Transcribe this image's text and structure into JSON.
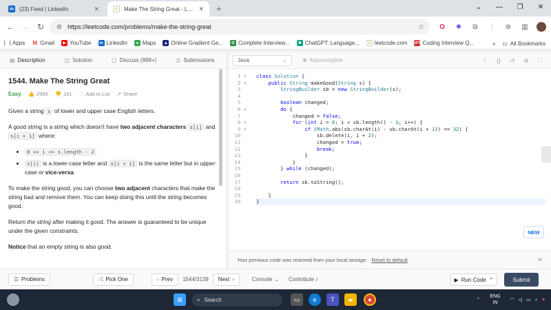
{
  "browser": {
    "tabs": [
      {
        "title": "(23) Feed | LinkedIn",
        "favicon": "linkedin-icon",
        "active": false
      },
      {
        "title": "Make The String Great - LeetCo",
        "favicon": "leetcode-icon",
        "active": true
      }
    ],
    "url": "https://leetcode.com/problems/make-the-string-great",
    "bookmarks": [
      {
        "label": "Apps",
        "icon": "apps-icon"
      },
      {
        "label": "Gmail",
        "icon": "gmail-icon"
      },
      {
        "label": "YouTube",
        "icon": "youtube-icon"
      },
      {
        "label": "LinkedIn",
        "icon": "linkedin-icon"
      },
      {
        "label": "Maps",
        "icon": "maps-icon"
      },
      {
        "label": "Online Gradient Ge...",
        "icon": "gradient-icon"
      },
      {
        "label": "Complete Interview...",
        "icon": "gfg-icon"
      },
      {
        "label": "ChatGPT: Language...",
        "icon": "chatgpt-icon"
      },
      {
        "label": "leetcode.com",
        "icon": "leetcode-icon"
      },
      {
        "label": "Coding Interview Q...",
        "icon": "coding-icon"
      }
    ],
    "all_bookmarks": "All Bookmarks"
  },
  "lc_tabs": [
    {
      "label": "Description",
      "icon": "description-icon"
    },
    {
      "label": "Solution",
      "icon": "solution-icon"
    },
    {
      "label": "Discuss (999+)",
      "icon": "discuss-icon"
    },
    {
      "label": "Submissions",
      "icon": "submissions-icon"
    }
  ],
  "problem": {
    "title": "1544. Make The String Great",
    "difficulty": "Easy",
    "likes": "2955",
    "dislikes": "161",
    "add_to_list": "Add to List",
    "share": "Share",
    "p1a": "Given a string ",
    "p1code": "s",
    "p1b": " of lower and upper case English letters.",
    "p2a": "A good string is a string which doesn't have ",
    "p2bold": "two adjacent characters",
    "p2code1": "s[i]",
    "p2and": " and ",
    "p2code2": "s[i + 1]",
    "p2b": " where:",
    "b1code": "0 <= i <= s.length - 2",
    "b2code1": "s[i]",
    "b2a": " is a lower-case letter and ",
    "b2code2": "s[i + 1]",
    "b2b": " is the same letter but in upper-case or ",
    "b2bold": "vice-versa",
    "b2c": ".",
    "p3a": "To make the string good, you can choose ",
    "p3bold": "two adjacent",
    "p3b": " characters that make the string bad and remove them. You can keep doing this until the string becomes good.",
    "p4a": "Return ",
    "p4em": "the string",
    "p4b": " after making it good. The answer is guaranteed to be unique under the given constraints.",
    "p5bold": "Notice",
    "p5b": " that an empty string is also good."
  },
  "editor": {
    "language": "Java",
    "autocomplete": "Autocomplete",
    "code_lines": [
      "class Solution {",
      "    public String makeGood(String s) {",
      "        StringBuilder sb = new StringBuilder(s);",
      "",
      "        boolean changed;",
      "        do {",
      "            changed = false;",
      "            for (int i = 0; i < sb.length() - 1; i++) {",
      "                if (Math.abs(sb.charAt(i) - sb.charAt(i + 1)) == 32) {",
      "                    sb.delete(i, i + 2);",
      "                    changed = true;",
      "                    break;",
      "                }",
      "            }",
      "        } while (changed);",
      "",
      "        return sb.toString();",
      "",
      "    }",
      "}"
    ],
    "fold_lines": [
      1,
      2,
      6,
      8,
      9
    ],
    "current_line": 20,
    "new_badge": "NEW",
    "restore_msg": "Your previous code was restored from your local storage.",
    "reset_link": "Reset to default"
  },
  "footer": {
    "problems": "Problems",
    "pick_one": "Pick One",
    "prev": "Prev",
    "page": "1544/3139",
    "next": "Next",
    "console": "Console",
    "contribute": "Contribute",
    "run_code": "Run Code",
    "submit": "Submit"
  },
  "taskbar": {
    "search": "Search",
    "lang_line1": "ENG",
    "lang_line2": "IN"
  }
}
